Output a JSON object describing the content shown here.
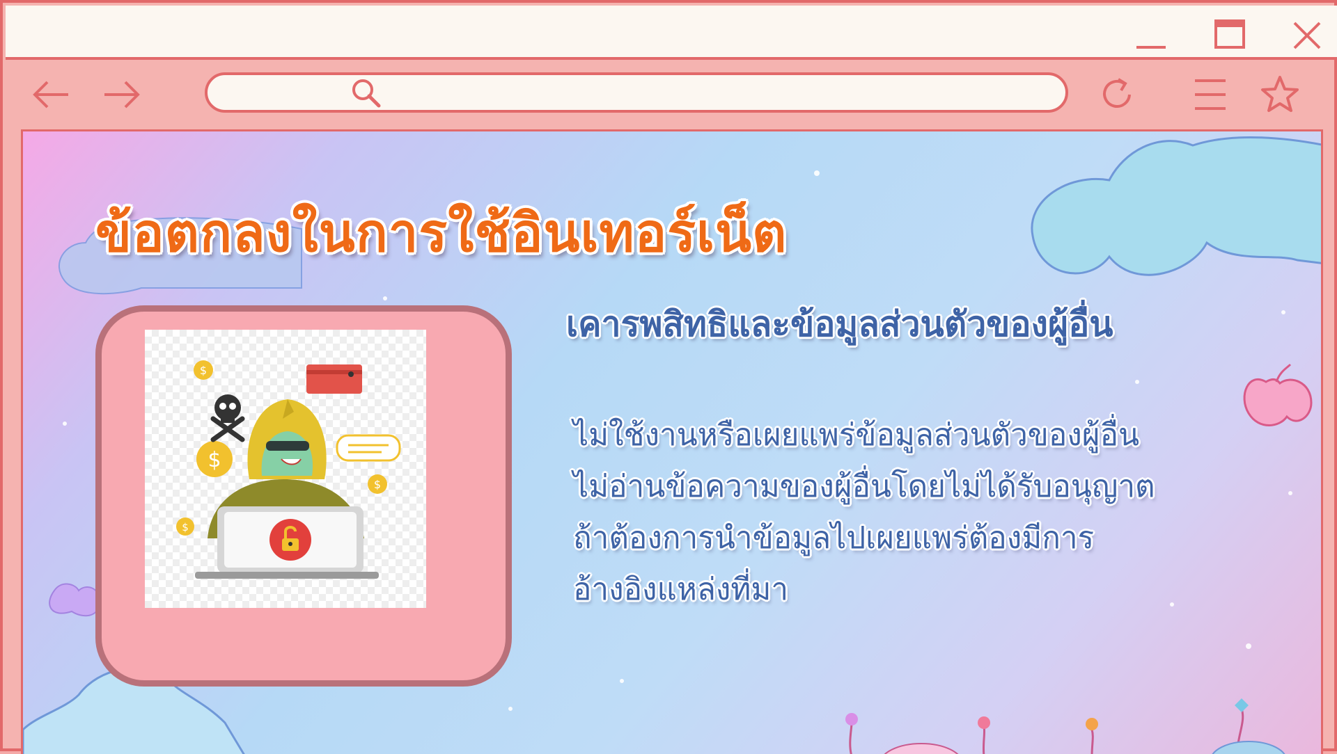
{
  "browser": {
    "window_controls": [
      "minimize-icon",
      "maximize-icon",
      "close-icon"
    ],
    "nav": [
      "back-arrow-icon",
      "forward-arrow-icon"
    ],
    "address_bar": {
      "value": "",
      "icon": "search-icon"
    },
    "actions": [
      "reload-icon",
      "menu-icon",
      "star-icon"
    ],
    "colors": {
      "frame": "#e2696a",
      "chrome": "#f5b3b0",
      "bar_bg": "#fcf7f1"
    }
  },
  "slide": {
    "title": "ข้อตกลงในการใช้อินเทอร์เน็ต",
    "subtitle": "เคารพสิทธิและข้อมูลส่วนตัวของผู้อื่น",
    "rules": [
      "ไม่ใช้งานหรือเผยแพร่ข้อมูลส่วนตัวของผู้อื่น",
      "ไม่อ่านข้อความของผู้อื่นโดยไม่ได้รับอนุญาต",
      "ถ้าต้องการนำข้อมูลไปเผยแพร่ต้องมีการ",
      "อ้างอิงแหล่งที่มา"
    ],
    "illustration": "hacker-with-laptop-illustration",
    "colors": {
      "title": "#ef6a16",
      "body_text": "#3e63a6",
      "photo_frame": "#f8a9b1"
    }
  }
}
